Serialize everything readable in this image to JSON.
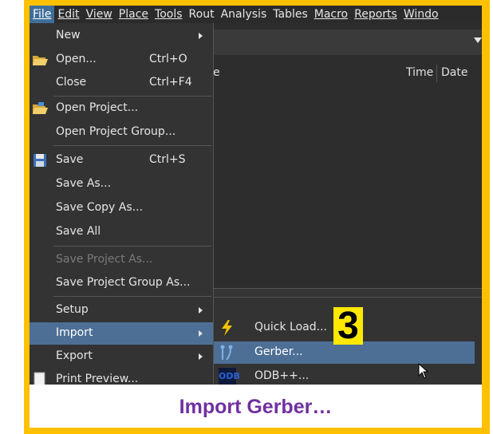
{
  "menubar": {
    "items": [
      {
        "label": "File",
        "active": true
      },
      {
        "label": "Edit"
      },
      {
        "label": "View"
      },
      {
        "label": "Place"
      },
      {
        "label": "Tools"
      },
      {
        "label": "Rout"
      },
      {
        "label": "Analysis"
      },
      {
        "label": "Tables"
      },
      {
        "label": "Macro"
      },
      {
        "label": "Reports"
      },
      {
        "label": "Windo"
      }
    ]
  },
  "background_panel": {
    "column_e": "e",
    "column_time": "Time",
    "column_date": "Date"
  },
  "file_menu": {
    "new": {
      "label": "New"
    },
    "open": {
      "label": "Open...",
      "shortcut": "Ctrl+O"
    },
    "close": {
      "label": "Close",
      "shortcut": "Ctrl+F4"
    },
    "open_project": {
      "label": "Open Project..."
    },
    "open_project_group": {
      "label": "Open Project Group..."
    },
    "save": {
      "label": "Save",
      "shortcut": "Ctrl+S"
    },
    "save_as": {
      "label": "Save As..."
    },
    "save_copy_as": {
      "label": "Save Copy As..."
    },
    "save_all": {
      "label": "Save All"
    },
    "save_project_as": {
      "label": "Save Project As...",
      "disabled": true
    },
    "save_project_group_as": {
      "label": "Save Project Group As..."
    },
    "setup": {
      "label": "Setup"
    },
    "import": {
      "label": "Import"
    },
    "export": {
      "label": "Export"
    },
    "print_preview": {
      "label": "Print Preview..."
    }
  },
  "import_submenu": {
    "quick_load": {
      "label": "Quick Load..."
    },
    "gerber": {
      "label": "Gerber..."
    },
    "odb": {
      "label": "ODB++...",
      "icon_text": "ODB"
    }
  },
  "step_badge": "3",
  "caption": "Import Gerber…",
  "colors": {
    "border": "#FFC000",
    "highlight": "#4D6F95",
    "badge": "#FFE800",
    "caption": "#7030A0"
  }
}
